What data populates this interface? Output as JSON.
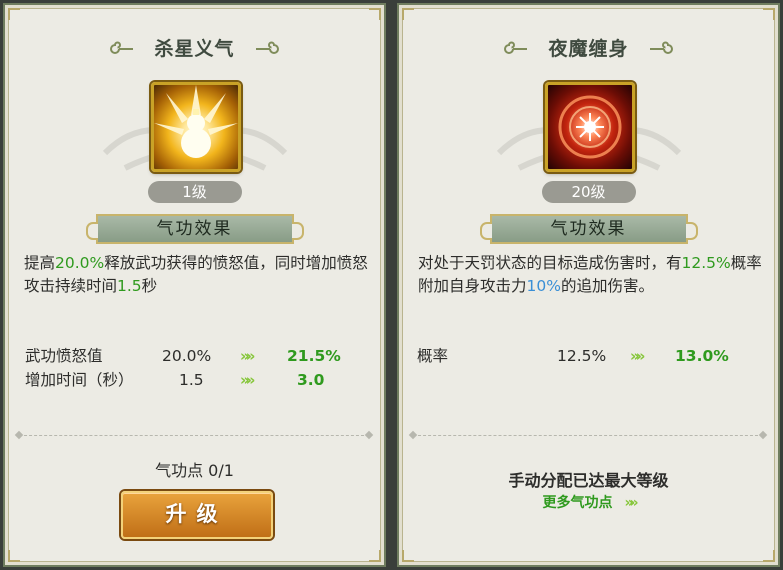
{
  "left_panel": {
    "title": "杀星义气",
    "level": "1级",
    "section_label": "气功效果",
    "desc": {
      "p1": "提高",
      "v1": "20.0%",
      "p2": "释放武功获得的愤怒值，同时增加愤怒攻击持续时间",
      "v2": "1.5",
      "p3": "秒"
    },
    "stats": [
      {
        "name": "武功愤怒值",
        "current": "20.0%",
        "next": "21.5%"
      },
      {
        "name": "增加时间（秒）",
        "current": "1.5",
        "next": "3.0"
      }
    ],
    "points_label": "气功点 0/1",
    "upgrade_button": "升级"
  },
  "right_panel": {
    "title": "夜魔缠身",
    "level": "20级",
    "section_label": "气功效果",
    "desc": {
      "p1": "对处于天罚状态的目标造成伤害时，有",
      "v1": "12.5%",
      "p2": "概率附加自身攻击力",
      "v2": "10%",
      "p3": "的追加伤害。"
    },
    "stats": [
      {
        "name": "概率",
        "current": "12.5%",
        "next": "13.0%"
      }
    ],
    "max_label": "手动分配已达最大等级",
    "more_points_link": "更多气功点"
  },
  "icons": {
    "left_skill": "golden-gourd-burst-icon",
    "right_skill": "crimson-vortex-sigil-icon",
    "arrow": "double-chevron-right-icon",
    "title_ornament": "cloud-scroll-ornament-icon"
  },
  "colors": {
    "highlight_green": "#2f9a1e",
    "highlight_blue": "#3a8fd6",
    "arrow_green": "#86c63a",
    "button_orange": "#c06f17"
  }
}
